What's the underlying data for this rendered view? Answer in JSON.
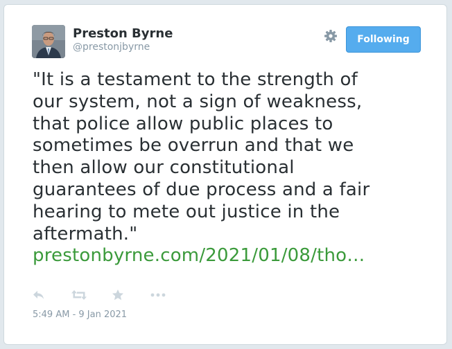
{
  "author": {
    "name": "Preston Byrne",
    "handle": "@prestonjbyrne"
  },
  "header": {
    "settings_icon": "gear-icon",
    "follow_button_label": "Following"
  },
  "tweet": {
    "lines": [
      "\"It is a testament to the strength of",
      "our system, not a sign of weakness,",
      "that police allow public places to",
      "sometimes be overrun and that we",
      "then allow our constitutional",
      "guarantees of due process and a fair",
      "hearing to mete out justice in the",
      "aftermath.\""
    ],
    "link_text": "prestonbyrne.com/2021/01/08/tho…"
  },
  "actions": {
    "icons": [
      "reply-icon",
      "retweet-icon",
      "favorite-icon",
      "more-icon"
    ]
  },
  "timestamp": "5:49 AM - 9 Jan 2021",
  "colors": {
    "background": "#e1e8ed",
    "card": "#ffffff",
    "text": "#292f33",
    "muted": "#8899a6",
    "link": "#3b9a3b",
    "button": "#55acee",
    "icon": "#ccd6dd"
  }
}
